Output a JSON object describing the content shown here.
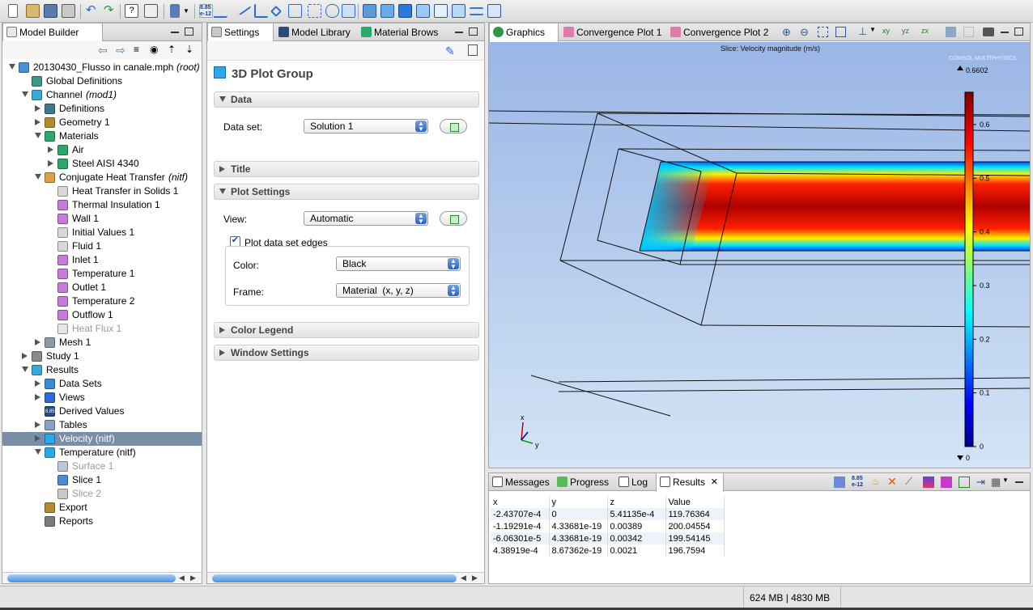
{
  "model_builder": {
    "tab_label": "Model Builder",
    "tree": [
      {
        "label": "20130430_Flusso in canale.mph",
        "suffix": "(root)",
        "level": 0,
        "expander": "open",
        "icon_color": "#4a90d9"
      },
      {
        "label": "Global Definitions",
        "level": 1,
        "expander": "none",
        "icon_color": "#3a9a8a"
      },
      {
        "label": "Channel",
        "suffix": "(mod1)",
        "level": 1,
        "expander": "open",
        "icon_color": "#3aa9d9"
      },
      {
        "label": "Definitions",
        "level": 2,
        "expander": "closed",
        "icon_color": "#3a7a8a"
      },
      {
        "label": "Geometry 1",
        "level": 2,
        "expander": "closed",
        "icon_color": "#b58a2a"
      },
      {
        "label": "Materials",
        "level": 2,
        "expander": "open",
        "icon_color": "#2aa96a"
      },
      {
        "label": "Air",
        "level": 3,
        "expander": "closed",
        "icon_color": "#2aa96a"
      },
      {
        "label": "Steel AISI 4340",
        "level": 3,
        "expander": "closed",
        "icon_color": "#2aa96a"
      },
      {
        "label": "Conjugate Heat Transfer",
        "suffix": "(nitf)",
        "level": 2,
        "expander": "open",
        "icon_color": "#e0a040"
      },
      {
        "label": "Heat Transfer in Solids 1",
        "level": 3,
        "expander": "none",
        "icon_color": "#d8d8d8"
      },
      {
        "label": "Thermal Insulation 1",
        "level": 3,
        "expander": "none",
        "icon_color": "#c87ad8"
      },
      {
        "label": "Wall 1",
        "level": 3,
        "expander": "none",
        "icon_color": "#c87ad8"
      },
      {
        "label": "Initial Values 1",
        "level": 3,
        "expander": "none",
        "icon_color": "#d8d8d8"
      },
      {
        "label": "Fluid 1",
        "level": 3,
        "expander": "none",
        "icon_color": "#d8d8d8"
      },
      {
        "label": "Inlet 1",
        "level": 3,
        "expander": "none",
        "icon_color": "#c87ad8"
      },
      {
        "label": "Temperature 1",
        "level": 3,
        "expander": "none",
        "icon_color": "#c87ad8"
      },
      {
        "label": "Outlet 1",
        "level": 3,
        "expander": "none",
        "icon_color": "#c87ad8"
      },
      {
        "label": "Temperature 2",
        "level": 3,
        "expander": "none",
        "icon_color": "#c87ad8"
      },
      {
        "label": "Outflow 1",
        "level": 3,
        "expander": "none",
        "icon_color": "#c87ad8"
      },
      {
        "label": "Heat Flux 1",
        "level": 3,
        "expander": "none",
        "icon_color": "#e6e6e6",
        "dim": true
      },
      {
        "label": "Mesh 1",
        "level": 2,
        "expander": "closed",
        "icon_color": "#8a9aaa"
      },
      {
        "label": "Study 1",
        "level": 1,
        "expander": "closed",
        "icon_color": "#8a8a8a"
      },
      {
        "label": "Results",
        "level": 1,
        "expander": "open",
        "icon_color": "#3aa9d9"
      },
      {
        "label": "Data Sets",
        "level": 2,
        "expander": "closed",
        "icon_color": "#3a8ad9"
      },
      {
        "label": "Views",
        "level": 2,
        "expander": "closed",
        "icon_color": "#2a6ad9"
      },
      {
        "label": "Derived Values",
        "level": 2,
        "expander": "none",
        "icon_color": "#2a4a8a",
        "icon_text": "8.85"
      },
      {
        "label": "Tables",
        "level": 2,
        "expander": "closed",
        "icon_color": "#8aa0c0"
      },
      {
        "label": "Velocity (nitf)",
        "level": 2,
        "expander": "closed",
        "icon_color": "#2aa9e9",
        "selected": true
      },
      {
        "label": "Temperature (nitf)",
        "level": 2,
        "expander": "open",
        "icon_color": "#2aa9e9"
      },
      {
        "label": "Surface 1",
        "level": 3,
        "expander": "none",
        "icon_color": "#b8c8d8",
        "dim": true
      },
      {
        "label": "Slice 1",
        "level": 3,
        "expander": "none",
        "icon_color": "#4a8ad9"
      },
      {
        "label": "Slice 2",
        "level": 3,
        "expander": "none",
        "icon_color": "#c8c8c8",
        "dim": true
      },
      {
        "label": "Export",
        "level": 2,
        "expander": "none",
        "icon_color": "#b58a2a"
      },
      {
        "label": "Reports",
        "level": 2,
        "expander": "none",
        "icon_color": "#7a7a7a"
      }
    ]
  },
  "settings": {
    "tabs": [
      "Settings",
      "Model Library",
      "Material Brows"
    ],
    "heading": "3D Plot Group",
    "sections": {
      "data": "Data",
      "title": "Title",
      "plot_settings": "Plot Settings",
      "color_legend": "Color Legend",
      "window_settings": "Window Settings"
    },
    "data_set_label": "Data set:",
    "data_set_value": "Solution 1",
    "view_label": "View:",
    "view_value": "Automatic",
    "plot_edges_label": "Plot data set edges",
    "plot_edges_checked": true,
    "color_label": "Color:",
    "color_value": "Black",
    "frame_label": "Frame:",
    "frame_value": "Material  (x, y, z)"
  },
  "graphics": {
    "tabs": [
      "Graphics",
      "Convergence Plot 1",
      "Convergence Plot 2"
    ],
    "plot_title": "Slice: Velocity magnitude (m/s)",
    "logo_text": "COMSOL MULTIPHYSICS",
    "colorbar_max": "0.6602",
    "colorbar_min": "0",
    "colorbar_ticks": [
      "0.6",
      "0.5",
      "0.4",
      "0.3",
      "0.2",
      "0.1",
      "0"
    ],
    "axis_x": "x",
    "axis_y": "y",
    "axis_z": "z",
    "background_top": "#9ab6e6",
    "background_bottom": "#d4e4f6"
  },
  "bottom_panel": {
    "tabs": [
      "Messages",
      "Progress",
      "Log",
      "Results"
    ],
    "headers": [
      "x",
      "y",
      "z",
      "Value"
    ],
    "rows": [
      [
        "-2.43707e-4",
        "0",
        "5.41135e-4",
        "119.76364"
      ],
      [
        "-1.19291e-4",
        "4.33681e-19",
        "0.00389",
        "200.04554"
      ],
      [
        "-6.06301e-5",
        "4.33681e-19",
        "0.00342",
        "199.54145"
      ],
      [
        "4.38919e-4",
        "8.67362e-19",
        "0.0021",
        "196.7594"
      ]
    ]
  },
  "status_bar": {
    "memory": "624 MB | 4830 MB"
  },
  "toolbar": {
    "derived_icon_text": "8.85\ne-12"
  }
}
